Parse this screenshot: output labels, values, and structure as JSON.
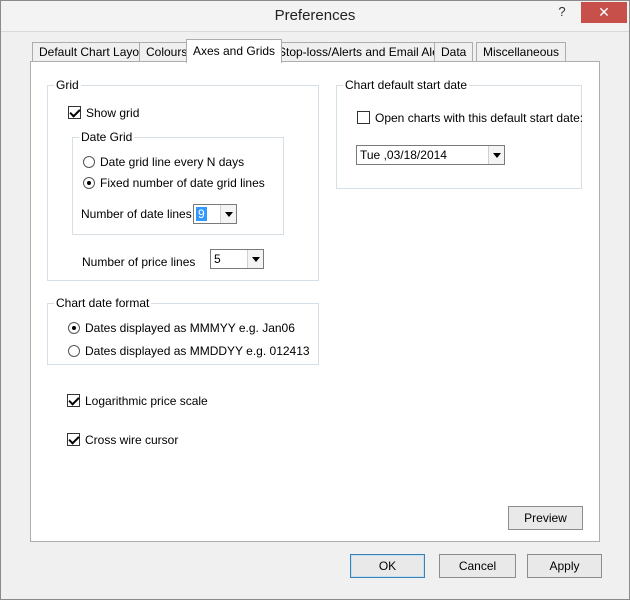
{
  "window": {
    "title": "Preferences",
    "help_label": "?",
    "close_label": "✕"
  },
  "tabs": [
    {
      "label": "Default Chart Layout"
    },
    {
      "label": "Colours"
    },
    {
      "label": "Axes and Grids"
    },
    {
      "label": "Stop-loss/Alerts and Email Alerts"
    },
    {
      "label": "Data"
    },
    {
      "label": "Miscellaneous"
    }
  ],
  "active_tab": "Axes and Grids",
  "grid": {
    "label": "Grid",
    "show_grid": {
      "label": "Show grid",
      "checked": true
    },
    "date_grid": {
      "label": "Date Grid",
      "options": [
        {
          "label": "Date grid line every N days",
          "selected": false
        },
        {
          "label": "Fixed number of date grid lines",
          "selected": true
        }
      ],
      "number_of_date_lines": {
        "label": "Number of date lines",
        "value": "9"
      }
    },
    "number_of_price_lines": {
      "label": "Number of price lines",
      "value": "5"
    }
  },
  "chart_date_format": {
    "label": "Chart date format",
    "options": [
      {
        "label": "Dates displayed as MMMYY e.g. Jan06",
        "selected": true
      },
      {
        "label": "Dates displayed as MMDDYY e.g. 012413",
        "selected": false
      }
    ]
  },
  "chart_default_start_date": {
    "label": "Chart default start date",
    "open_with_default": {
      "label": "Open charts with this default start date:",
      "checked": false
    },
    "date_value": "Tue ,03/18/2014"
  },
  "logarithmic_price_scale": {
    "label": "Logarithmic price scale",
    "checked": true
  },
  "cross_wire_cursor": {
    "label": "Cross wire cursor",
    "checked": true
  },
  "buttons": {
    "preview": "Preview",
    "ok": "OK",
    "cancel": "Cancel",
    "apply": "Apply"
  }
}
